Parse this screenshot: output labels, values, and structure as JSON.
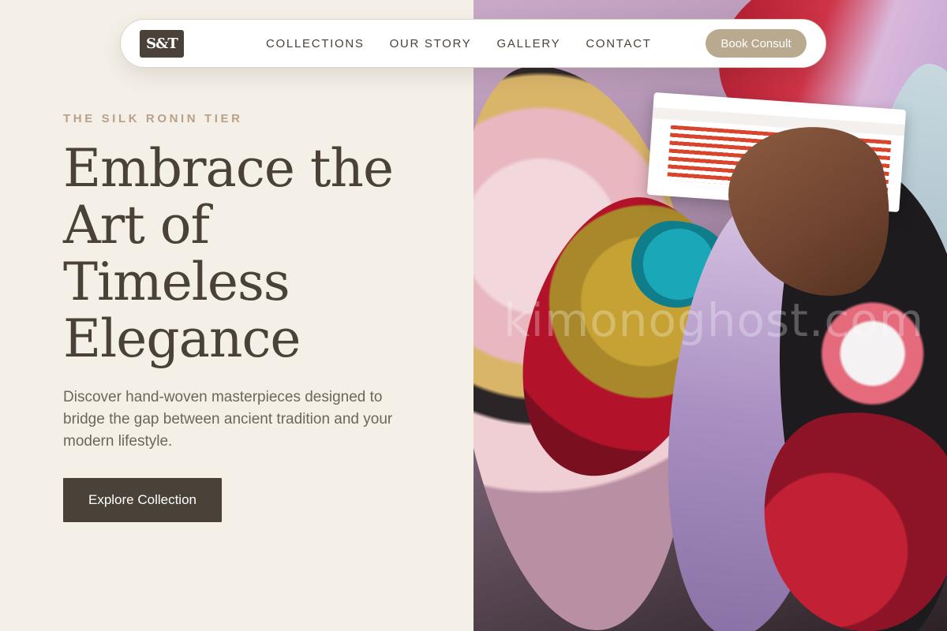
{
  "nav": {
    "logo_text": "S&T",
    "links": [
      "COLLECTIONS",
      "OUR STORY",
      "GALLERY",
      "CONTACT"
    ],
    "cta_label": "Book Consult"
  },
  "hero": {
    "eyebrow": "THE SILK RONIN TIER",
    "headline": "Embrace the Art of Timeless Elegance",
    "subtext": "Discover hand-woven masterpieces designed to bridge the gap between ancient tradition and your modern lifestyle.",
    "cta_label": "Explore Collection",
    "watermark": "kimonoghost.com"
  },
  "colors": {
    "page_bg": "#f4f0e8",
    "text_dark": "#4a4238",
    "accent_tan": "#b9a98e",
    "eyebrow": "#b9a08a"
  }
}
